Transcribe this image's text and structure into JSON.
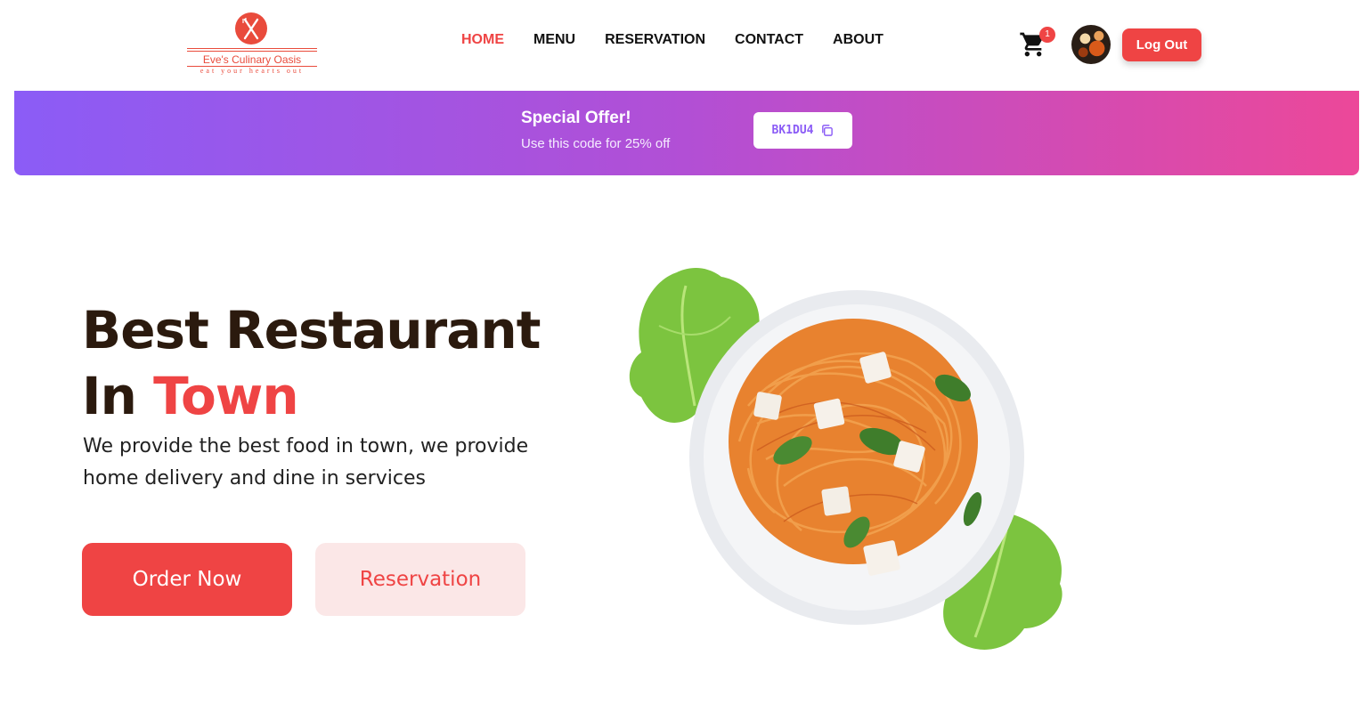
{
  "header": {
    "logo": {
      "name": "Eve's Culinary Oasis",
      "tagline": "eat your hearts out",
      "icon": "fork-knife-icon"
    },
    "nav": [
      {
        "label": "HOME",
        "active": true
      },
      {
        "label": "MENU",
        "active": false
      },
      {
        "label": "RESERVATION",
        "active": false
      },
      {
        "label": "CONTACT",
        "active": false
      },
      {
        "label": "ABOUT",
        "active": false
      }
    ],
    "cart": {
      "icon": "shopping-cart-icon",
      "count": "1"
    },
    "avatar": {
      "icon": "user-avatar"
    },
    "logout_label": "Log Out"
  },
  "promo": {
    "title": "Special Offer!",
    "subtitle": "Use this code for 25% off",
    "code": "BK1DU4",
    "code_icon": "copy-icon"
  },
  "hero": {
    "title_line1": "Best Restaurant",
    "title_line2_prefix": "In ",
    "title_line2_accent": "Town",
    "description": "We provide the best food in town, we provide home delivery and dine in services",
    "order_button": "Order Now",
    "reservation_button": "Reservation",
    "image": "spaghetti-plate-illustration"
  },
  "colors": {
    "accent": "#ef4444",
    "accent_soft": "#fbe7e7",
    "heading": "#2b1a0e",
    "promo_gradient_start": "#8b5cf6",
    "promo_gradient_end": "#ec4899"
  }
}
